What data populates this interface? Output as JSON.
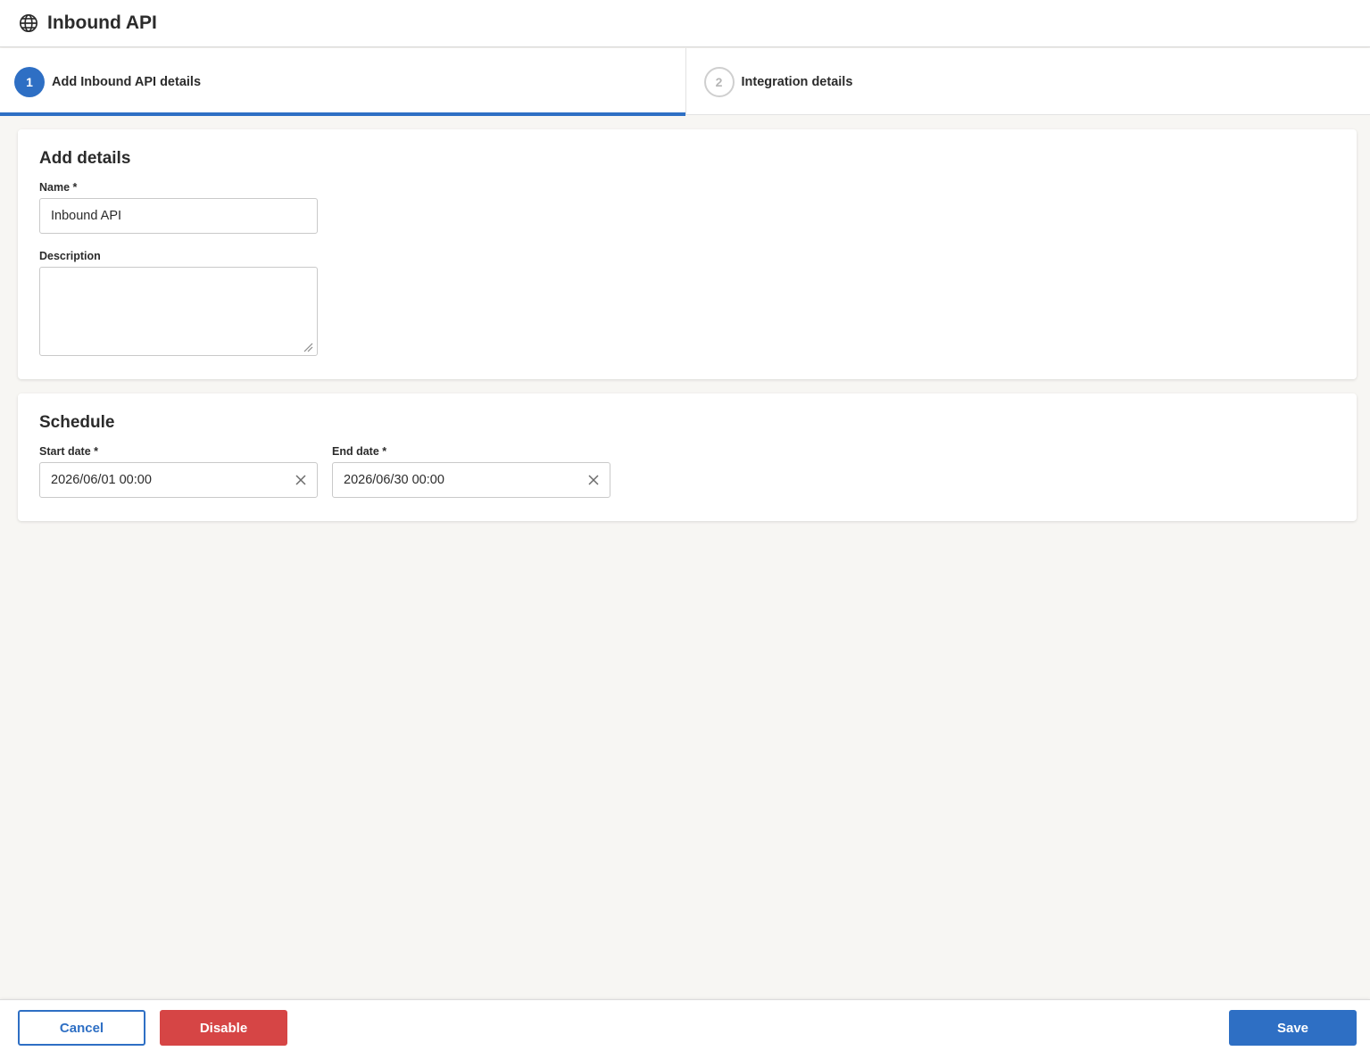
{
  "header": {
    "title": "Inbound API",
    "icon": "globe-icon"
  },
  "stepper": {
    "steps": [
      {
        "number": "1",
        "label": "Add Inbound API details",
        "state": "active"
      },
      {
        "number": "2",
        "label": "Integration details",
        "state": "inactive"
      }
    ]
  },
  "details": {
    "heading": "Add details",
    "name_label": "Name *",
    "name_value": "Inbound API",
    "description_label": "Description",
    "description_value": ""
  },
  "schedule": {
    "heading": "Schedule",
    "start_label": "Start date *",
    "start_value": "2026/06/01 00:00",
    "end_label": "End date *",
    "end_value": "2026/06/30 00:00"
  },
  "footer": {
    "cancel_label": "Cancel",
    "disable_label": "Disable",
    "save_label": "Save"
  },
  "colors": {
    "accent": "#2e6fc4",
    "danger": "#d64545",
    "background": "#f7f6f3"
  }
}
